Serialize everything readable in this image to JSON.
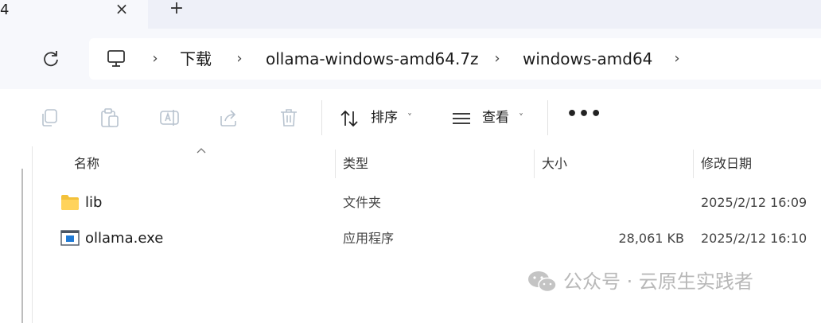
{
  "tabs": {
    "fragment": "4",
    "close_glyph": "×",
    "new_glyph": "+"
  },
  "breadcrumb": {
    "items": [
      "下载",
      "ollama-windows-amd64.7z",
      "windows-amd64"
    ],
    "separator": "›"
  },
  "toolbar": {
    "sort_label": "排序",
    "view_label": "查看",
    "caret": "˅",
    "more_glyph": "•••"
  },
  "columns": [
    "名称",
    "类型",
    "大小",
    "修改日期"
  ],
  "files": [
    {
      "name": "lib",
      "type": "文件夹",
      "size": "",
      "modified": "2025/2/12 16:09",
      "icon": "folder-icon"
    },
    {
      "name": "ollama.exe",
      "type": "应用程序",
      "size": "28,061 KB",
      "modified": "2025/2/12 16:10",
      "icon": "application-icon"
    }
  ],
  "watermark": {
    "text": "公众号 · 云原生实践者",
    "icon": "wechat-icon"
  },
  "colors": {
    "chrome": "#eef0f8",
    "folder": "#f3c13a",
    "accent": "#0067c0"
  }
}
